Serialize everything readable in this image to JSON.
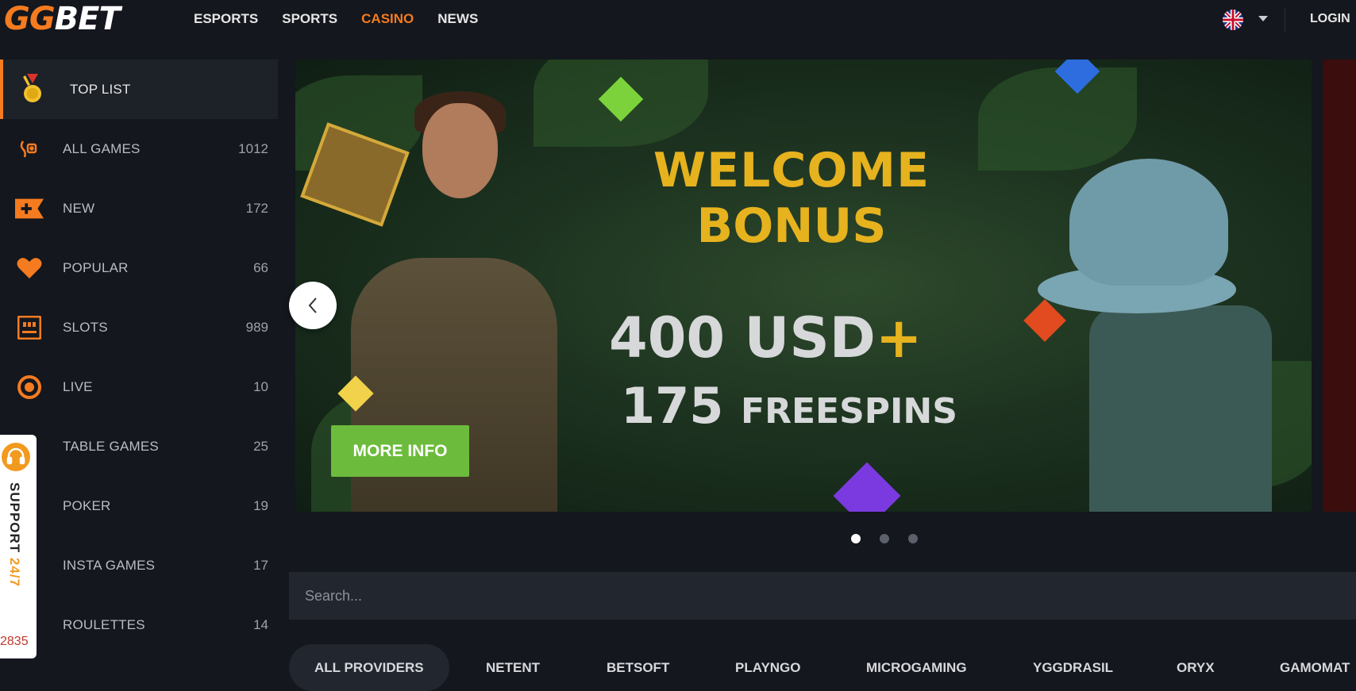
{
  "header": {
    "logo_gg": "GG",
    "logo_bet": "BET",
    "nav": [
      "ESPORTS",
      "SPORTS",
      "CASINO",
      "NEWS"
    ],
    "active_nav": "CASINO",
    "login_label": "LOGIN",
    "language_icon": "uk-flag-icon"
  },
  "sidebar": {
    "items": [
      {
        "label": "TOP LIST",
        "count": "",
        "icon": "medal-icon"
      },
      {
        "label": "ALL GAMES",
        "count": "1012",
        "icon": "dice-hand-icon"
      },
      {
        "label": "NEW",
        "count": "172",
        "icon": "new-plus-icon"
      },
      {
        "label": "POPULAR",
        "count": "66",
        "icon": "heart-icon"
      },
      {
        "label": "SLOTS",
        "count": "989",
        "icon": "slot-machine-icon"
      },
      {
        "label": "LIVE",
        "count": "10",
        "icon": "live-circle-icon"
      },
      {
        "label": "TABLE GAMES",
        "count": "25",
        "icon": "table-icon"
      },
      {
        "label": "POKER",
        "count": "19",
        "icon": "poker-icon"
      },
      {
        "label": "INSTA GAMES",
        "count": "17",
        "icon": "insta-icon"
      },
      {
        "label": "ROULETTES",
        "count": "14",
        "icon": "roulette-icon"
      }
    ]
  },
  "support": {
    "label_main": "SUPPORT ",
    "label_hours": "24/7",
    "number": "2835"
  },
  "banner": {
    "line1": "WELCOME",
    "line2": "BONUS",
    "amount": "400 USD",
    "plus": "+",
    "spins_num": "175",
    "spins_label": "FREESPINS",
    "cta": "MORE INFO",
    "slides": 3,
    "active_slide": 1
  },
  "search": {
    "placeholder": "Search..."
  },
  "providers": [
    "ALL PROVIDERS",
    "NETENT",
    "BETSOFT",
    "PLAYNGO",
    "MICROGAMING",
    "YGGDRASIL",
    "ORYX",
    "GAMOMAT"
  ],
  "colors": {
    "accent": "#f47b20",
    "background": "#14171d",
    "cta_green": "#6dbb3c",
    "bonus_gold": "#e6b21e"
  }
}
